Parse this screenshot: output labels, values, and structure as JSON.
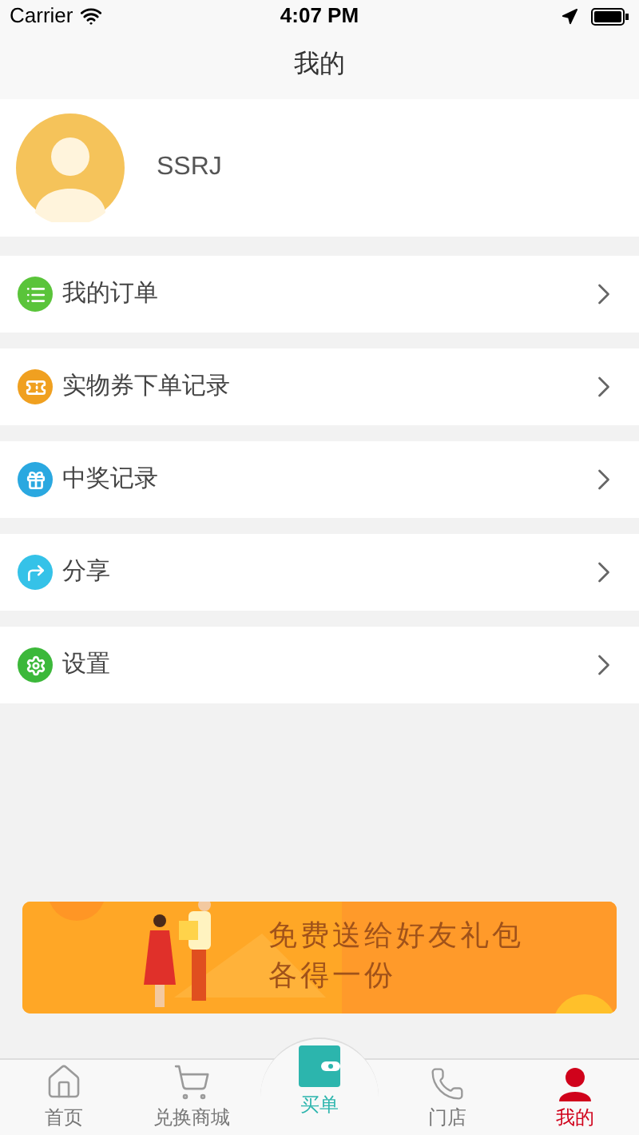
{
  "status_bar": {
    "carrier": "Carrier",
    "time": "4:07 PM"
  },
  "nav": {
    "title": "我的"
  },
  "profile": {
    "name": "SSRJ"
  },
  "menu": [
    {
      "label": "我的订单",
      "kind": "list",
      "color": "#5ac43a"
    },
    {
      "label": "实物券下单记录",
      "kind": "ticket",
      "color": "#f0a020"
    },
    {
      "label": "中奖记录",
      "kind": "gift",
      "color": "#2aa8e0"
    },
    {
      "label": "分享",
      "kind": "share",
      "color": "#35c2e8"
    },
    {
      "label": "设置",
      "kind": "gear",
      "color": "#3cb83a"
    }
  ],
  "banner": {
    "lines": [
      "免费送给好友礼包",
      "各得一份"
    ]
  },
  "tabs": [
    {
      "label": "首页",
      "kind": "home",
      "selected": false
    },
    {
      "label": "兑换商城",
      "kind": "cart",
      "selected": false
    },
    {
      "label": "买单",
      "kind": "wallet",
      "selected": false
    },
    {
      "label": "门店",
      "kind": "phone",
      "selected": false
    },
    {
      "label": "我的",
      "kind": "user",
      "selected": true
    }
  ]
}
